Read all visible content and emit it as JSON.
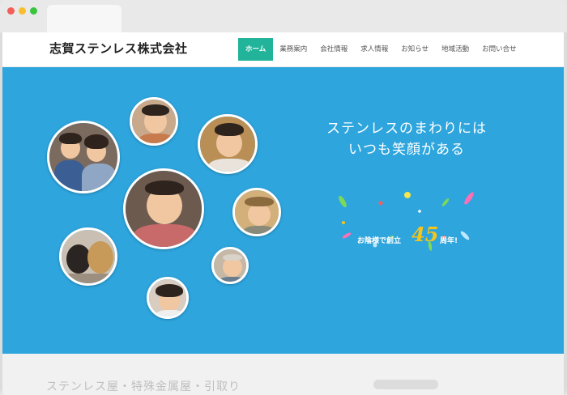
{
  "site": {
    "logo": "志賀ステンレス株式会社"
  },
  "nav": {
    "items": [
      {
        "label": "ホーム",
        "active": true
      },
      {
        "label": "業務案内",
        "active": false
      },
      {
        "label": "会社情報",
        "active": false
      },
      {
        "label": "求人情報",
        "active": false
      },
      {
        "label": "お知らせ",
        "active": false
      },
      {
        "label": "地域活動",
        "active": false
      },
      {
        "label": "お問い合せ",
        "active": false
      }
    ]
  },
  "hero": {
    "tagline_line1": "ステンレスのまわりには",
    "tagline_line2": "いつも笑顔がある",
    "anniversary_prefix": "お陰様で創立",
    "anniversary_number": "45",
    "anniversary_suffix": "周年!",
    "background_color": "#2ea5dd"
  },
  "colors": {
    "accent": "#22b49a",
    "number_gold": "#f5c518"
  },
  "below_fold": {
    "heading_partial": "ステンレス屋・特殊金属屋・引取り"
  }
}
